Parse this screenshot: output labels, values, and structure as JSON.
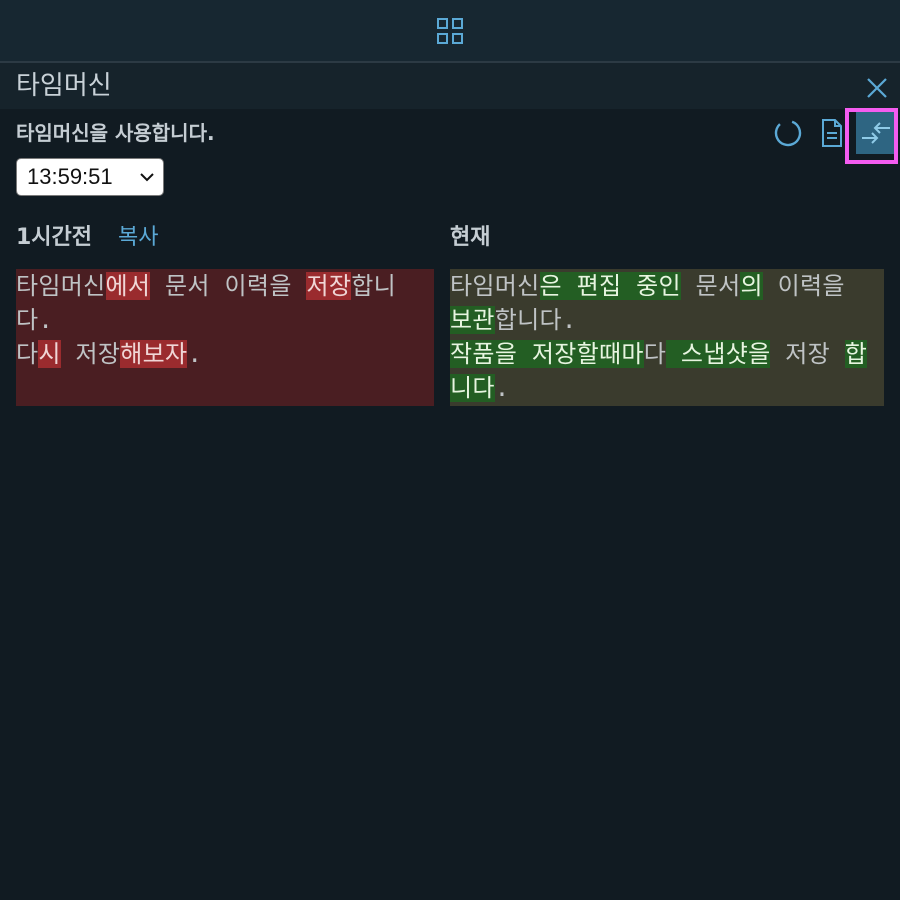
{
  "panel": {
    "title": "타임머신",
    "subtitle": "타임머신을 사용합니다.",
    "time_value": "13:59:51"
  },
  "toolbar": {
    "icons": [
      "history-icon",
      "document-icon",
      "compare-arrows-icon"
    ],
    "active": "compare-arrows-icon",
    "highlight_color": "#f45cf0"
  },
  "columns": {
    "left_title": "1시간전",
    "copy_label": "복사",
    "right_title": "현재"
  },
  "colors": {
    "background": "#111b22",
    "accent": "#5ba9d6",
    "deleted_bg": "#9a2b2e",
    "inserted_bg": "#235e23"
  },
  "diff": {
    "left_lines": [
      [
        {
          "t": "타임머신",
          "s": "plain"
        },
        {
          "t": "에서",
          "s": "del"
        },
        {
          "t": " 문서 이력을 ",
          "s": "plain"
        },
        {
          "t": "저장",
          "s": "del"
        },
        {
          "t": "합니다.",
          "s": "plain"
        }
      ],
      [
        {
          "t": "다",
          "s": "plain"
        },
        {
          "t": "시",
          "s": "del"
        },
        {
          "t": " 저장",
          "s": "plain"
        },
        {
          "t": "해보자",
          "s": "del"
        },
        {
          "t": ".",
          "s": "plain"
        }
      ]
    ],
    "right_lines": [
      [
        {
          "t": "타임머신",
          "s": "plain"
        },
        {
          "t": "은 편집 중인",
          "s": "ins"
        },
        {
          "t": " 문서",
          "s": "plain"
        },
        {
          "t": "의",
          "s": "ins"
        },
        {
          "t": " 이력을 ",
          "s": "plain"
        },
        {
          "t": "보관",
          "s": "ins"
        },
        {
          "t": "합니다.",
          "s": "plain"
        }
      ],
      [
        {
          "t": "작품을 저장할때마",
          "s": "ins"
        },
        {
          "t": "다",
          "s": "plain"
        },
        {
          "t": " 스냅샷을",
          "s": "ins"
        },
        {
          "t": " 저장 ",
          "s": "plain"
        },
        {
          "t": "합니다",
          "s": "ins"
        },
        {
          "t": ".",
          "s": "plain"
        }
      ]
    ]
  }
}
